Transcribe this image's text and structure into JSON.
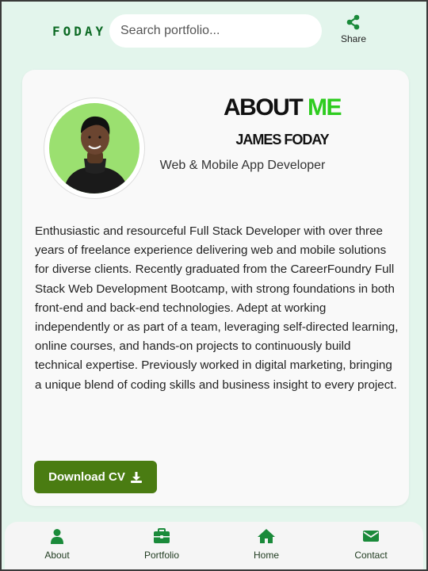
{
  "header": {
    "logo_text": "FODAY",
    "search_placeholder": "Search portfolio...",
    "share_label": "Share"
  },
  "profile": {
    "title_word1": "ABOUT",
    "title_word2": "ME",
    "name": "JAMES FODAY",
    "role": "Web & Mobile App Developer",
    "bio": "Enthusiastic and resourceful Full Stack Developer with over three years of freelance experience delivering web and mobile solutions for diverse clients. Recently graduated from the CareerFoundry Full Stack Web Development Bootcamp, with strong foundations in both front-end and back-end technologies. Adept at working independently or as part of a team, leveraging self-directed learning, online courses, and hands-on projects to continuously build technical expertise. Previously worked in digital marketing, bringing a unique blend of coding skills and business insight to every project.",
    "download_label": "Download CV"
  },
  "bottom_nav": {
    "items": [
      {
        "label": "About",
        "icon": "user-icon"
      },
      {
        "label": "Portfolio",
        "icon": "briefcase-icon"
      },
      {
        "label": "Home",
        "icon": "home-icon"
      },
      {
        "label": "Contact",
        "icon": "envelope-icon"
      }
    ]
  },
  "colors": {
    "accent_green": "#0d6b25",
    "title_green": "#2ecc1f",
    "button_green": "#4a7c12",
    "page_bg": "#e3f5ec",
    "avatar_bg": "#9be070"
  }
}
